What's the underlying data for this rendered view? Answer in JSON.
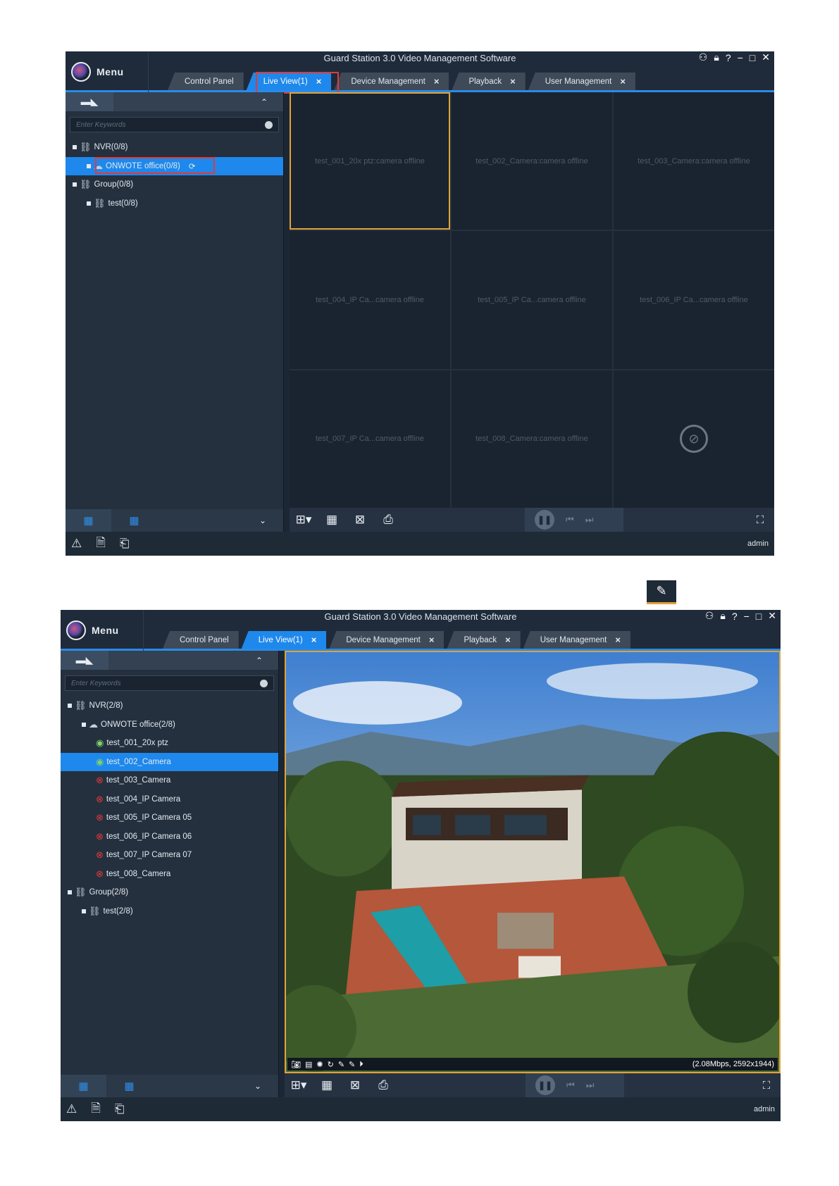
{
  "app": {
    "title": "Guard Station 3.0 Video Management Software",
    "menu_label": "Menu",
    "user": "admin",
    "header_icons": [
      "org-icon",
      "lock-icon",
      "help-icon",
      "minimize-icon",
      "maximize-icon",
      "close-icon"
    ],
    "tabs": [
      {
        "label": "Control Panel",
        "closable": false
      },
      {
        "label": "Live View(1)",
        "closable": true
      },
      {
        "label": "Device Management",
        "closable": true
      },
      {
        "label": "Playback",
        "closable": true
      },
      {
        "label": "User Management",
        "closable": true
      }
    ],
    "close_glyph": "×",
    "search_placeholder": "Enter Keywords"
  },
  "w1": {
    "tree": [
      {
        "label": "NVR(0/8)",
        "level": 0,
        "icon": "nvr-icon"
      },
      {
        "label": "ONWOTE office(0/8)",
        "level": 1,
        "icon": "device-icon",
        "selected": true,
        "refreshing": true
      },
      {
        "label": "Group(0/8)",
        "level": 0,
        "icon": "group-icon"
      },
      {
        "label": "test(0/8)",
        "level": 1,
        "icon": "group-icon"
      }
    ],
    "cells": [
      "test_001_20x ptz:camera offline",
      "test_002_Camera:camera offline",
      "test_003_Camera:camera offline",
      "test_004_IP Ca...camera offline",
      "test_005_IP Ca...camera offline",
      "test_006_IP Ca...camera offline",
      "test_007_IP Ca...camera offline",
      "test_008_Camera:camera offline",
      ""
    ]
  },
  "w2": {
    "tree": [
      {
        "label": "NVR(2/8)",
        "level": 0
      },
      {
        "label": "ONWOTE office(2/8)",
        "level": 1
      },
      {
        "label": "test_001_20x ptz",
        "level": 2,
        "status": "online"
      },
      {
        "label": "test_002_Camera",
        "level": 2,
        "status": "online",
        "selected": true
      },
      {
        "label": "test_003_Camera",
        "level": 2,
        "status": "offline"
      },
      {
        "label": "test_004_IP Camera",
        "level": 2,
        "status": "offline"
      },
      {
        "label": "test_005_IP Camera 05",
        "level": 2,
        "status": "offline"
      },
      {
        "label": "test_006_IP Camera 06",
        "level": 2,
        "status": "offline"
      },
      {
        "label": "test_007_IP Camera 07",
        "level": 2,
        "status": "offline"
      },
      {
        "label": "test_008_Camera",
        "level": 2,
        "status": "offline"
      },
      {
        "label": "Group(2/8)",
        "level": 0
      },
      {
        "label": "test(2/8)",
        "level": 1
      }
    ],
    "stream_info": "(2.08Mbps, 2592x1944)",
    "video_tools": [
      "snapshot-icon",
      "record-icon",
      "focus-icon",
      "ptz-icon",
      "talk-icon",
      "mic-icon",
      "playback-icon"
    ]
  },
  "colors": {
    "accent": "#1e88ec",
    "highlight": "#e13a3a",
    "selection_border": "#e0a23a",
    "bg": "#1c2735"
  }
}
